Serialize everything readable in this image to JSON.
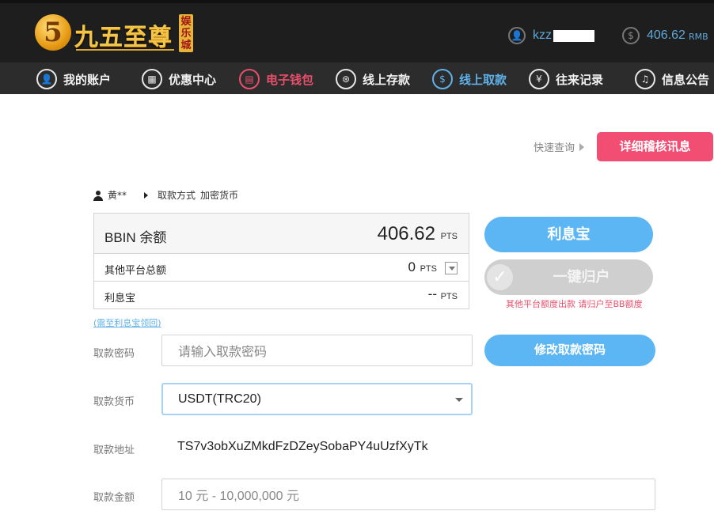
{
  "header": {
    "logo_text": "九五至尊",
    "logo_number": "5",
    "logo_badge": "娱乐城",
    "username": "kzz",
    "balance": "406.62",
    "currency": "RMB"
  },
  "nav": [
    {
      "label": "我的账户",
      "icon": "user-icon"
    },
    {
      "label": "优惠中心",
      "icon": "gift-icon"
    },
    {
      "label": "电子钱包",
      "icon": "wallet-icon"
    },
    {
      "label": "线上存款",
      "icon": "deposit-icon"
    },
    {
      "label": "线上取款",
      "icon": "withdraw-icon"
    },
    {
      "label": "往来记录",
      "icon": "records-icon"
    },
    {
      "label": "信息公告",
      "icon": "bell-icon"
    }
  ],
  "quick_query": "快速查询",
  "detail_button": "详细稽核讯息",
  "breadcrumb": {
    "user": "黄**",
    "method_label": "取款方式",
    "method_value": "加密货币"
  },
  "balance_panel": {
    "main_label": "BBIN 余额",
    "main_value": "406.62",
    "unit": "PTS",
    "other_label": "其他平台总额",
    "other_value": "0",
    "lixibao_label": "利息宝",
    "lixibao_value": "--"
  },
  "lixibao_link": "(需至利息宝领回)",
  "lixibao_button": "利息宝",
  "one_click_button": "一键归户",
  "one_click_note": "其他平台额度出款 请归户至BB额度",
  "form": {
    "password_label": "取款密码",
    "password_placeholder": "请输入取款密码",
    "change_password_button": "修改取款密码",
    "currency_label": "取款货币",
    "currency_value": "USDT(TRC20)",
    "address_label": "取款地址",
    "address_value": "TS7v3obXuZMkdFzDZeySobaPY4uUzfXyTk",
    "amount_label": "取款金额",
    "amount_placeholder": "10 元 - 10,000,000 元"
  }
}
